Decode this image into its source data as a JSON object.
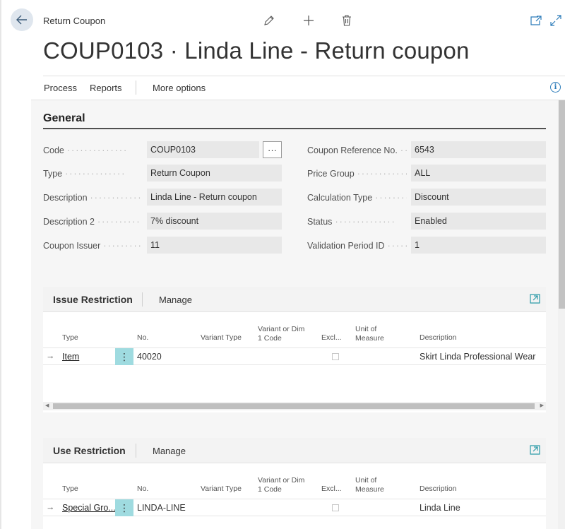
{
  "header": {
    "breadcrumb": "Return Coupon",
    "title": "COUP0103 · Linda Line - Return coupon"
  },
  "toolbar": {
    "edit_icon": "pencil-icon",
    "new_icon": "plus-icon",
    "delete_icon": "trash-icon",
    "open_new_window_icon": "open-in-new-window-icon",
    "collapse_icon": "expand-icon"
  },
  "menu": {
    "process": "Process",
    "reports": "Reports",
    "more_options": "More options"
  },
  "general": {
    "section_title": "General",
    "left_fields": [
      {
        "label": "Code",
        "value": "COUP0103"
      },
      {
        "label": "Type",
        "value": "Return Coupon"
      },
      {
        "label": "Description",
        "value": "Linda Line - Return coupon"
      },
      {
        "label": "Description 2",
        "value": "7% discount"
      },
      {
        "label": "Coupon Issuer",
        "value": "11"
      }
    ],
    "right_fields": [
      {
        "label": "Coupon Reference No.",
        "value": "6543"
      },
      {
        "label": "Price Group",
        "value": "ALL"
      },
      {
        "label": "Calculation Type",
        "value": "Discount"
      },
      {
        "label": "Status",
        "value": "Enabled"
      },
      {
        "label": "Validation Period ID",
        "value": "1"
      }
    ],
    "assist_label": "···"
  },
  "issue_restriction": {
    "title": "Issue Restriction",
    "manage": "Manage",
    "columns": {
      "type": "Type",
      "no": "No.",
      "variant_type": "Variant Type",
      "variant_dim_1": "Variant or Dim",
      "variant_dim_2": "1 Code",
      "excl": "Excl...",
      "uom_1": "Unit of",
      "uom_2": "Measure",
      "description": "Description"
    },
    "rows": [
      {
        "type": "Item",
        "no": "40020",
        "description": "Skirt Linda Professional Wear"
      }
    ]
  },
  "use_restriction": {
    "title": "Use Restriction",
    "manage": "Manage",
    "columns": {
      "type": "Type",
      "no": "No.",
      "variant_type": "Variant Type",
      "variant_dim_1": "Variant or Dim",
      "variant_dim_2": "1 Code",
      "excl": "Excl...",
      "uom_1": "Unit of",
      "uom_2": "Measure",
      "description": "Description"
    },
    "rows": [
      {
        "type": "Special Gro...",
        "no": "LINDA-LINE",
        "description": "Linda Line"
      }
    ]
  },
  "glyphs": {
    "row_arrow": "→",
    "kebab": "⋮"
  }
}
